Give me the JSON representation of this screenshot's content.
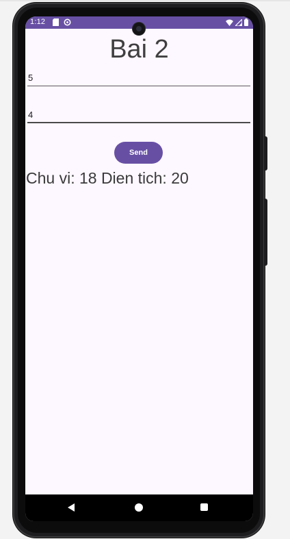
{
  "status_bar": {
    "time": "1:12",
    "background_color": "#6750a4",
    "left_icons": [
      "sd-card-icon",
      "data-saver-icon"
    ],
    "right_icons": [
      "wifi-icon",
      "cell-signal-icon",
      "battery-icon"
    ]
  },
  "app": {
    "title": "Bai 2",
    "field_one_value": "5",
    "field_two_value": "4",
    "send_label": "Send",
    "result_text": "Chu vi: 18 Dien tich: 20",
    "accent_color": "#6750a4",
    "background_color": "#fdf7ff"
  },
  "nav_bar": {
    "buttons": [
      "back-icon",
      "home-icon",
      "recents-icon"
    ]
  }
}
